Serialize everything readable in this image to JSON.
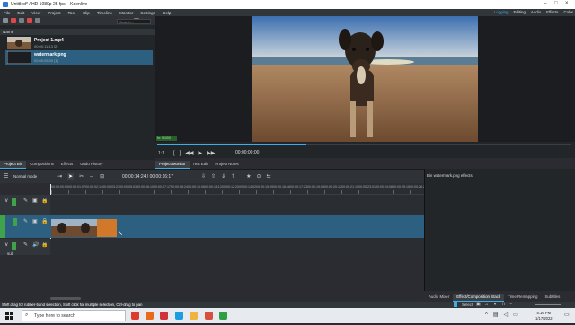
{
  "window": {
    "title": "Untitled* / HD 1080p 25 fps – Kdenlive"
  },
  "menu": [
    "File",
    "Edit",
    "View",
    "Project",
    "Tool",
    "Clip",
    "Timeline",
    "Monitor",
    "Settings",
    "Help"
  ],
  "layouts": [
    "Logging",
    "Editing",
    "Audio",
    "Effects",
    "Color"
  ],
  "bin": {
    "search_placeholder": "Search...",
    "header": "Name",
    "clips": [
      {
        "name": "Project 1.mp4",
        "meta": "00:00:11:13 [2]",
        "selected": false
      },
      {
        "name": "watermark.png",
        "meta": "00:00:05:00 [1]",
        "selected": true
      }
    ]
  },
  "monitor": {
    "badge": "In: 9/10/0",
    "timecode": "00:00:00:00"
  },
  "left_tabs": [
    "Project Bin",
    "Compositions",
    "Effects",
    "Undo History"
  ],
  "monitor_tabs": [
    "Project Monitor",
    "Text Edit",
    "Project Notes"
  ],
  "timeline": {
    "edit_mode": "Normal mode",
    "timecode": "00:00:14:24 / 00:00:16:17",
    "ruler": [
      "00:00:00:00",
      "00:00:01:07",
      "00:00:02:14",
      "00:00:03:21",
      "00:00:05:03",
      "00:00:06:10",
      "00:00:07:17",
      "00:00:08:24",
      "00:00:10:06",
      "00:00:11:13",
      "00:00:12:20",
      "00:00:14:02",
      "00:00:15:09",
      "00:00:16:16",
      "00:00:17:23",
      "00:00:19:05",
      "00:00:20:12",
      "00:00:21:19",
      "00:00:23:01",
      "00:00:24:08",
      "00:00:25:15",
      "00:00:26:22"
    ],
    "track_labels": [
      "V2",
      "V1",
      "A1"
    ],
    "subtitle_label": "sub"
  },
  "effects_panel": {
    "title": "Bin watermark.png effects"
  },
  "effects_tabs": [
    "Audio Mixer",
    "Effect/Composition Stack",
    "Time Remapping",
    "Subtitles"
  ],
  "status": {
    "text": "Shift drag for rubber-band selection, Shift click for multiple selection, Ctrl-drag to pan",
    "mode": "Select"
  },
  "taskbar": {
    "search_placeholder": "Type here to search",
    "time": "5:16 PM",
    "date": "1/17/2022"
  }
}
